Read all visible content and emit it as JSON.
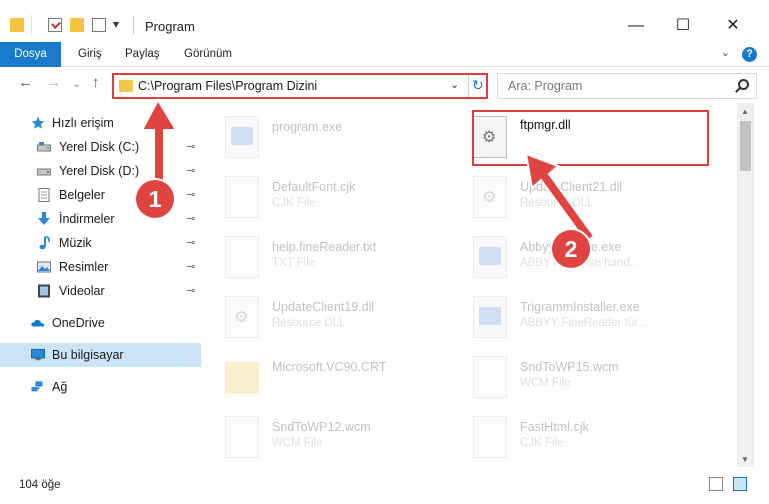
{
  "titlebar": {
    "title": "Program",
    "minimize": "—",
    "maximize": "☐",
    "close": "✕",
    "qa_dropdown": "▾"
  },
  "ribbon": {
    "tabs": [
      "Dosya",
      "Giriş",
      "Paylaş",
      "Görünüm"
    ],
    "chevron": "⌄",
    "help": "?"
  },
  "nav": {
    "back": "←",
    "forward": "→",
    "recent": "⌄",
    "up": "↑",
    "address": "C:\\Program Files\\Program Dizini",
    "address_dropdown": "⌄",
    "refresh": "↻",
    "search_placeholder": "Ara: Program"
  },
  "sidebar": {
    "items": [
      {
        "label": "Hızlı erişim",
        "icon": "star-icon",
        "pinned": false
      },
      {
        "label": "Yerel Disk (C:)",
        "icon": "drive-icon",
        "pinned": true
      },
      {
        "label": "Yerel Disk (D:)",
        "icon": "drive-icon",
        "pinned": true
      },
      {
        "label": "Belgeler",
        "icon": "document-icon",
        "pinned": true
      },
      {
        "label": "İndirmeler",
        "icon": "download-icon",
        "pinned": true
      },
      {
        "label": "Müzik",
        "icon": "music-icon",
        "pinned": true
      },
      {
        "label": "Resimler",
        "icon": "picture-icon",
        "pinned": true
      },
      {
        "label": "Videolar",
        "icon": "video-icon",
        "pinned": true
      },
      {
        "label": "OneDrive",
        "icon": "cloud-icon",
        "pinned": false
      },
      {
        "label": "Bu bilgisayar",
        "icon": "computer-icon",
        "pinned": false
      },
      {
        "label": "Ağ",
        "icon": "network-icon",
        "pinned": false
      }
    ],
    "pin_glyph": "📌"
  },
  "files": [
    {
      "name": "program.exe",
      "type": "",
      "icon": "app"
    },
    {
      "name": "ftpmgr.dll",
      "type": "",
      "icon": "gear"
    },
    {
      "name": "DefaultFont.cjk",
      "type": "CJK File",
      "icon": "doc"
    },
    {
      "name": "UpdateClient21.dll",
      "type": "Resource DLL",
      "icon": "gear"
    },
    {
      "name": "help.fineReader.txt",
      "type": "TXT File",
      "icon": "doc"
    },
    {
      "name": "AbbyyLicense.exe",
      "type": "ABBYY License hand...",
      "icon": "app"
    },
    {
      "name": "UpdateClient19.dll",
      "type": "Resource DLL",
      "icon": "gear"
    },
    {
      "name": "TrigrammInstaller.exe",
      "type": "ABBYY FineReader tür...",
      "icon": "app"
    },
    {
      "name": "Microsoft.VC90.CRT",
      "type": "",
      "icon": "folder"
    },
    {
      "name": "SndToWP15.wcm",
      "type": "WCM File",
      "icon": "doc"
    },
    {
      "name": "SndToWP12.wcm",
      "type": "WCM File",
      "icon": "doc"
    },
    {
      "name": "FastHtml.cjk",
      "type": "CJK File",
      "icon": "doc"
    }
  ],
  "status": {
    "count": "104 öğe"
  },
  "annotations": {
    "step1": "1",
    "step2": "2"
  },
  "colors": {
    "accent": "#1979ca",
    "highlight": "#d9403a"
  }
}
